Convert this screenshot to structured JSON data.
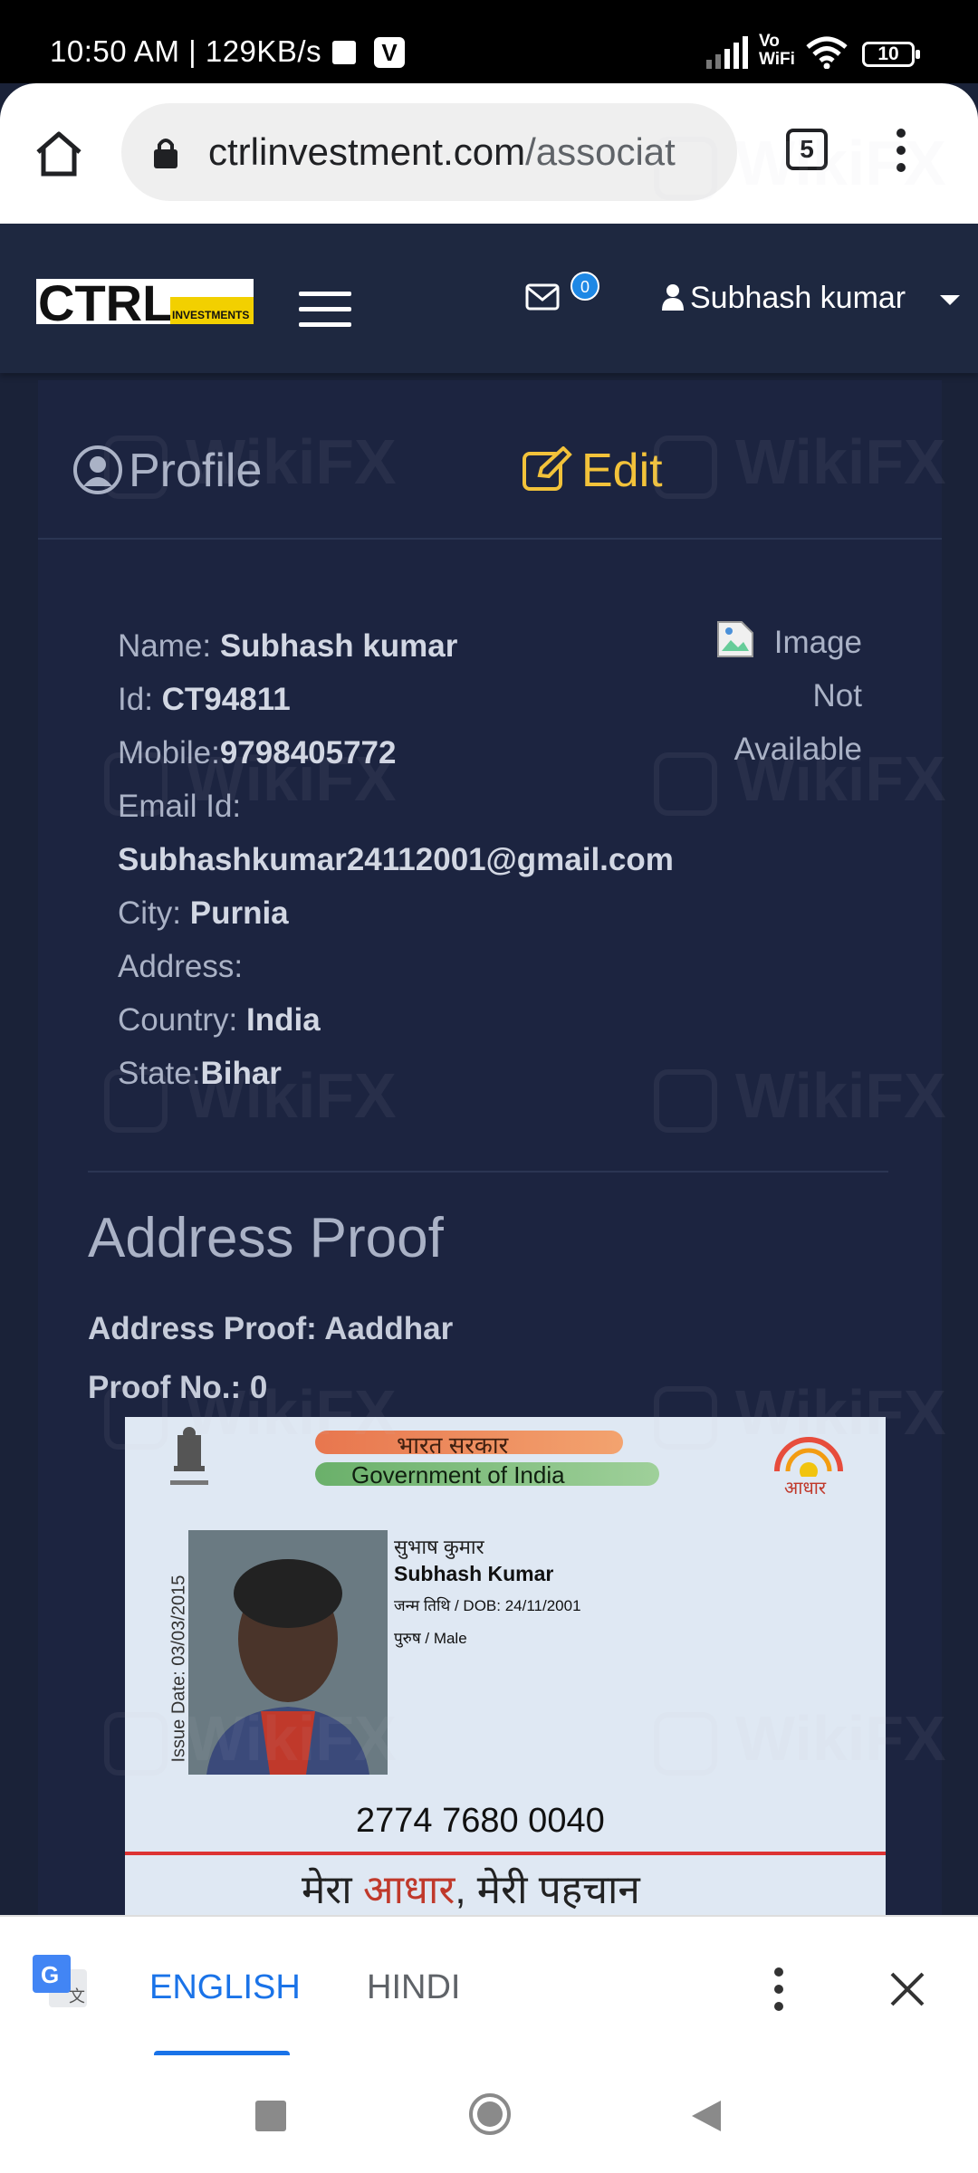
{
  "status_bar": {
    "time": "10:50 AM | 129KB/s",
    "app_letter": "V",
    "network": "Vo WiFi",
    "battery": "10"
  },
  "browser": {
    "url_domain": "ctrlinvestment.com",
    "url_path": "/associat",
    "tab_count": "5"
  },
  "navbar": {
    "logo_text": "CTRL",
    "logo_sub": "INVESTMENTS",
    "mail_count": "0",
    "user_name": "Subhash kumar"
  },
  "tabs": {
    "profile": "Profile",
    "edit": "Edit"
  },
  "profile": {
    "name_label": "Name: ",
    "name": "Subhash kumar",
    "id_label": "Id: ",
    "id": "CT94811",
    "mobile_label": "Mobile:",
    "mobile": "9798405772",
    "email_label": "Email Id:",
    "email": "Subhashkumar24112001@gmail.com",
    "city_label": "City: ",
    "city": "Purnia",
    "address_label": "Address:",
    "country_label": "Country: ",
    "country": "India",
    "state_label": "State:",
    "state": "Bihar",
    "image_alt_1": "Image",
    "image_alt_2": "Not",
    "image_alt_3": "Available"
  },
  "address_proof": {
    "title": "Address Proof",
    "type_line": "Address Proof: Aaddhar",
    "number_line": "Proof No.: 0"
  },
  "aadhaar_card": {
    "govt_hindi": "भारत सरकार",
    "govt_english": "Government of India",
    "logo_text": "आधार",
    "issue_date": "Issue Date: 03/03/2015",
    "name_hindi": "सुभाष कुमार",
    "name_english": "Subhash Kumar",
    "dob": "जन्म तिथि / DOB: 24/11/2001",
    "gender": "पुरुष / Male",
    "number": "2774 7680 0040",
    "tagline_1": "मेरा ",
    "tagline_2": "आधार",
    "tagline_3": ", मेरी पहचान"
  },
  "translate_bar": {
    "lang_source": "ENGLISH",
    "lang_target": "HINDI"
  },
  "watermark": "WikiFX",
  "colors": {
    "page_bg": "#1a2238",
    "accent_edit": "#f2c23a",
    "link_blue": "#1a73e8"
  }
}
